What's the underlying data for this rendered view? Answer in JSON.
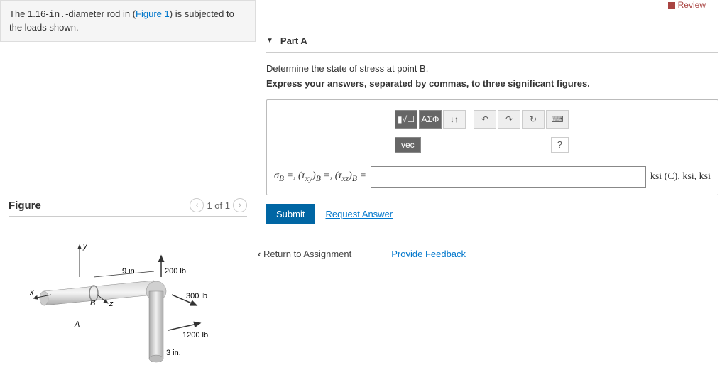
{
  "problem": {
    "prefix": "The 1.16-",
    "unit": "in.",
    "middle": "-diameter rod in (",
    "figlink": "Figure 1",
    "suffix": ") is subjected to the loads shown."
  },
  "figure": {
    "title": "Figure",
    "nav_label": "1 of 1",
    "labels": {
      "y": "y",
      "x": "x",
      "z": "z",
      "A": "A",
      "B": "B",
      "d9in": "9 in.",
      "d3in": "3 in.",
      "l200": "200 lb",
      "l300": "300 lb",
      "l1200": "1200 lb"
    }
  },
  "review": "Review",
  "part": {
    "title": "Part A",
    "instruction": "Determine the state of stress at point B.",
    "instruction2": "Express your answers, separated by commas, to three significant figures.",
    "toolbar": {
      "templates_icon": "▮√☐",
      "greek": "ΑΣΦ",
      "arrows": "↓↑",
      "undo": "↶",
      "redo": "↷",
      "reset": "↻",
      "keyboard": "⌨",
      "vec": "vec",
      "help": "?"
    },
    "equation_label": "σB =, (τxy)B =, (τxz)B =",
    "unit_label": "ksi (C), ksi, ksi",
    "submit": "Submit",
    "request": "Request Answer"
  },
  "footer": {
    "return": "Return to Assignment",
    "feedback": "Provide Feedback"
  }
}
